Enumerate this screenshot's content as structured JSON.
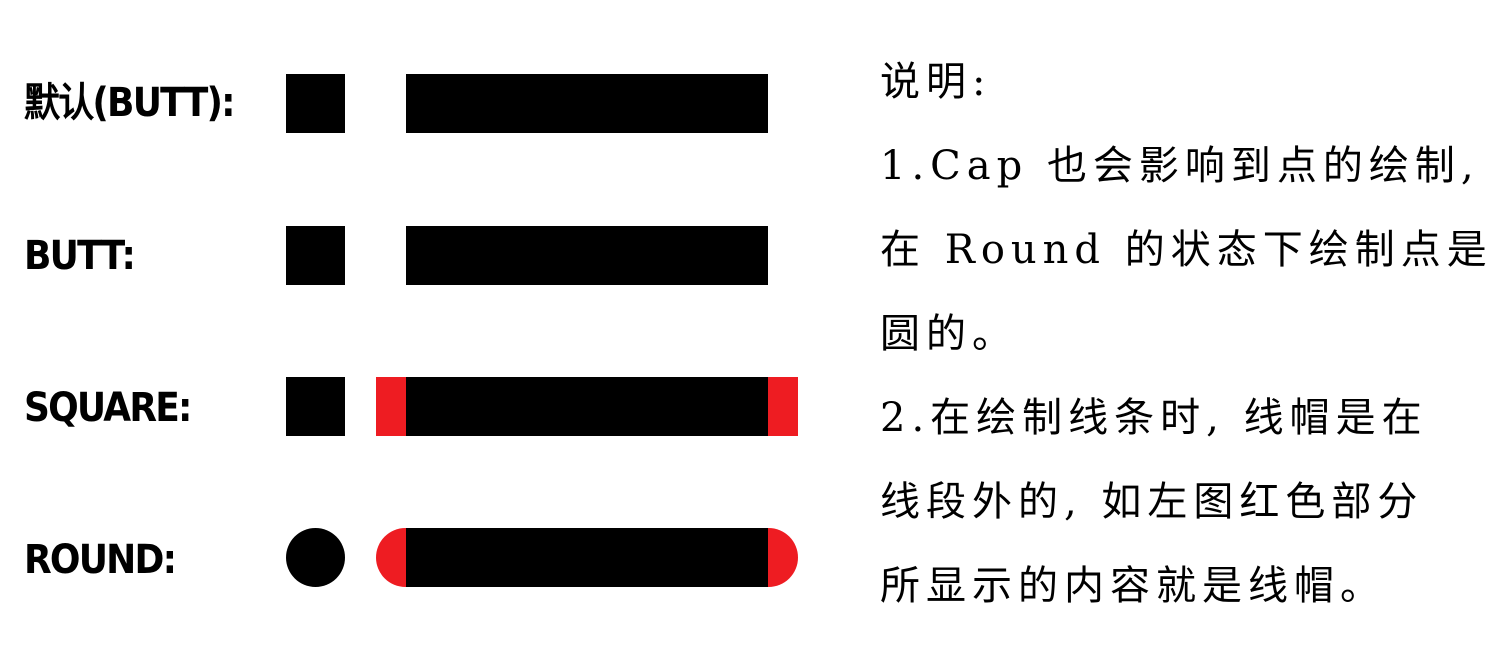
{
  "rows": [
    {
      "label": "默认(BUTT):",
      "cap": "butt"
    },
    {
      "label": "BUTT:",
      "cap": "butt"
    },
    {
      "label": "SQUARE:",
      "cap": "square"
    },
    {
      "label": "ROUND:",
      "cap": "round"
    }
  ],
  "notes": {
    "heading": "说明:",
    "lines": [
      "1.Cap 也会影响到点的绘制,",
      "在 Round 的状态下绘制点是",
      "圆的。",
      "2.在绘制线条时, 线帽是在",
      "线段外的, 如左图红色部分",
      "所显示的内容就是线帽。"
    ]
  },
  "colors": {
    "line": "#000000",
    "cap_highlight": "#ee1c22"
  }
}
